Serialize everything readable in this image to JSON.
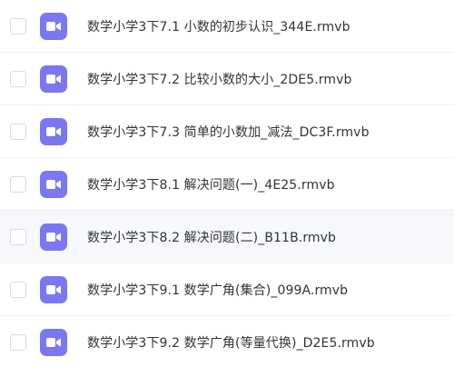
{
  "colors": {
    "video_icon_bg": "#7B77F2",
    "hover_row_bg": "#F7F8FC",
    "text": "#2F3339",
    "checkbox_border": "#D7DBE3"
  },
  "files": [
    {
      "name": "数学小学3下7.1 小数的初步认识_344E.rmvb",
      "icon": "video-file-icon"
    },
    {
      "name": "数学小学3下7.2 比较小数的大小_2DE5.rmvb",
      "icon": "video-file-icon"
    },
    {
      "name": "数学小学3下7.3 简单的小数加_减法_DC3F.rmvb",
      "icon": "video-file-icon"
    },
    {
      "name": "数学小学3下8.1 解决问题(一)_4E25.rmvb",
      "icon": "video-file-icon"
    },
    {
      "name": "数学小学3下8.2 解决问题(二)_B11B.rmvb",
      "icon": "video-file-icon",
      "hovered": true
    },
    {
      "name": "数学小学3下9.1 数学广角(集合)_099A.rmvb",
      "icon": "video-file-icon"
    },
    {
      "name": "数学小学3下9.2 数学广角(等量代换)_D2E5.rmvb",
      "icon": "video-file-icon"
    }
  ]
}
